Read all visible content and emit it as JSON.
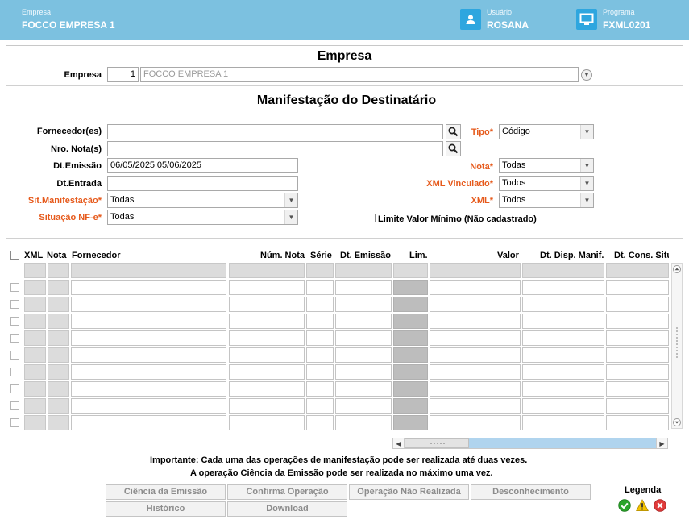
{
  "header": {
    "company_caption": "Empresa",
    "company_name": "FOCCO EMPRESA 1",
    "user_caption": "Usuário",
    "user_name": "ROSANA",
    "program_caption": "Programa",
    "program_code": "FXML0201"
  },
  "empresa_section": {
    "title": "Empresa",
    "label": "Empresa",
    "code": "1",
    "name": "FOCCO EMPRESA 1"
  },
  "manifest_section": {
    "title": "Manifestação do Destinatário"
  },
  "filters": {
    "fornecedor_label": "Fornecedor(es)",
    "fornecedor_value": "",
    "nro_nota_label": "Nro. Nota(s)",
    "nro_nota_value": "",
    "dt_emissao_label": "Dt.Emissão",
    "dt_emissao_value": "06/05/2025|05/06/2025",
    "dt_entrada_label": "Dt.Entrada",
    "dt_entrada_value": "",
    "sit_manifestacao_label": "Sit.Manifestação*",
    "sit_manifestacao_value": "Todas",
    "situacao_nfe_label": "Situação NF-e*",
    "situacao_nfe_value": "Todas",
    "tipo_label": "Tipo*",
    "tipo_value": "Código",
    "nota_label": "Nota*",
    "nota_value": "Todas",
    "xml_vinculado_label": "XML Vinculado*",
    "xml_vinculado_value": "Todos",
    "xml_label": "XML*",
    "xml_value": "Todos",
    "limite_label": "Limite Valor Mínimo (Não cadastrado)"
  },
  "grid": {
    "columns": [
      "XML",
      "Nota",
      "Fornecedor",
      "Núm. Nota",
      "Série",
      "Dt. Emissão",
      "Lim.",
      "Valor",
      "Dt. Disp. Manif.",
      "Dt. Cons. Situ"
    ]
  },
  "notes": {
    "line1": "Importante: Cada uma das operações de manifestação pode ser realizada até duas vezes.",
    "line2": "A operação Ciência da Emissão pode ser realizada no máximo uma vez."
  },
  "buttons": {
    "ciencia": "Ciência da Emissão",
    "confirma": "Confirma Operação",
    "nao_realizada": "Operação Não Realizada",
    "desconhecimento": "Desconhecimento",
    "historico": "Histórico",
    "download": "Download"
  },
  "legend": {
    "title": "Legenda",
    "colors": {
      "ok": "#2aa52a",
      "warn": "#f2c200",
      "error": "#e03a3a"
    }
  },
  "colors": {
    "header_bg": "#7cc1e0",
    "accent": "#2ea6df",
    "required": "#e65a1c"
  }
}
